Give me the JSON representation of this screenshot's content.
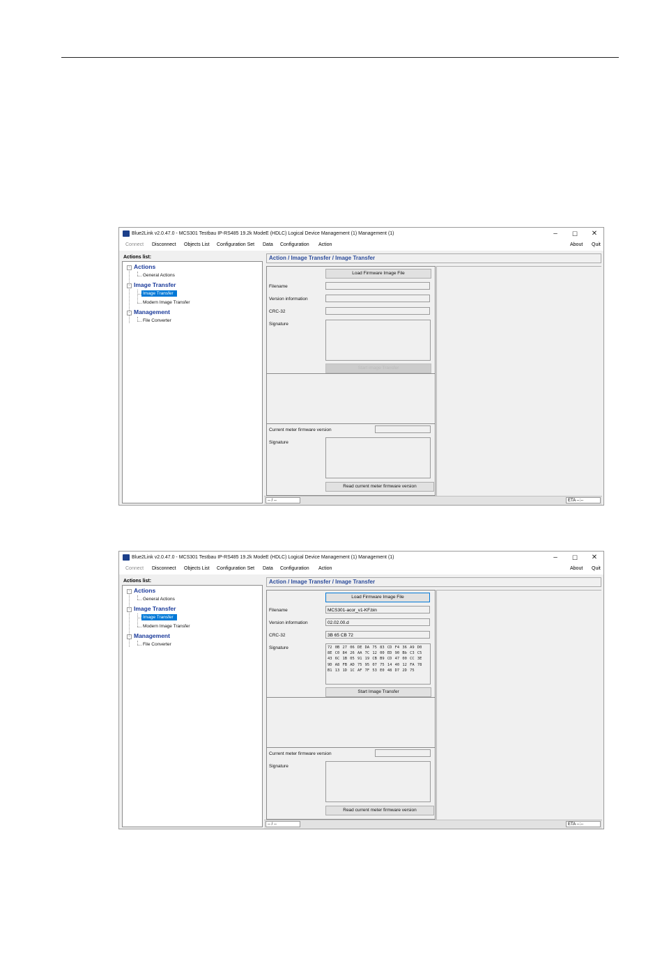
{
  "title": "Blue2Link v2.0.47.0 - MCS301  Testbau IP-RS485 19.2k ModeE (HDLC)  Logical Device Management (1)  Management (1)",
  "menu": {
    "connect": "Connect",
    "disconnect": "Disconnect",
    "objects_list": "Objects List",
    "configuration_set": "Configuration Set",
    "data": "Data",
    "configuration": "Configuration",
    "action": "Action",
    "about": "About",
    "quit": "Quit"
  },
  "window_controls": {
    "minimize": "–",
    "maximize": "☐",
    "close": "✕"
  },
  "actions_list_label": "Actions list:",
  "tree": {
    "actions": "Actions",
    "general_actions": "General Actions",
    "image_transfer": "Image Transfer",
    "image_transfer_item": "Image Transfer",
    "modern_image_transfer": "Modern Image Transfer",
    "management": "Management",
    "file_converter": "File Converter"
  },
  "breadcrumb": "Action / Image Transfer / Image Transfer",
  "labels": {
    "load_firmware": "Load Firmware Image File",
    "filename": "Filename",
    "version_information": "Version information",
    "crc32": "CRC-32",
    "signature": "Signature",
    "start_image_transfer": "Start Image Transfer",
    "start_image_transfer_disabled": "Start image Transfer",
    "current_meter_firmware_version": "Current meter firmware version",
    "read_current_meter_firmware_version": "Read current meter firmware version"
  },
  "status": {
    "left": "-- / --",
    "right": "ETA --:--"
  },
  "screen2": {
    "filename": "MCS301-acor_v1-KF.bin",
    "version_information": "02.02.00.d",
    "crc32": "3B 65 CB 72",
    "signature": "72 0B 27 06 DE DA 75 83 CD F4 36 A9 D0 8E C0 84 26 AA 7C 12 00 ED 90 Bb C3 C5 43 6C 1B 05 91 19 CB B9 CD 47 00 CC 3E 9D A8 FB AD 75 95 07 75 14 40 12 FA 78 B1 13 1D 1C AF 7F 53 E0 48 D7 2D 75"
  },
  "colors": {
    "tree_group": "#1a3a9a",
    "breadcrumb": "#2a4a9a",
    "selection": "#0078d7",
    "app_icon": "#1c3f8a"
  }
}
